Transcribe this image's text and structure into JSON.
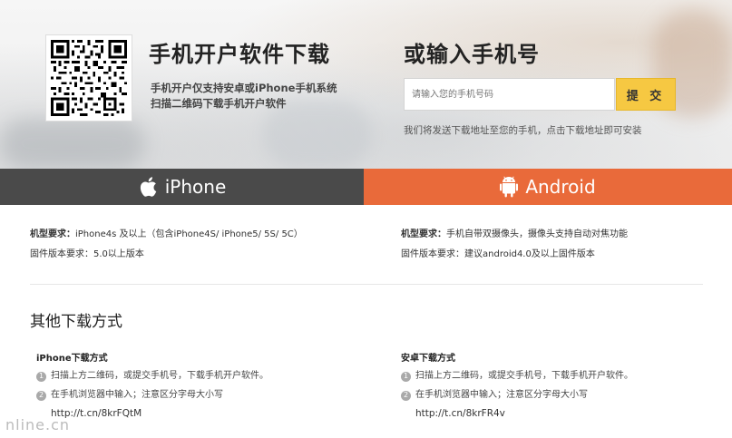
{
  "hero": {
    "download_title": "手机开户软件下载",
    "download_desc_1": "手机开户仅支持安卓或iPhone手机系统",
    "download_desc_2": "扫描二维码下载手机开户软件",
    "phone_title": "或输入手机号",
    "phone_placeholder": "请输入您的手机号码",
    "submit_label": "提 交",
    "phone_note": "我们将发送下载地址至您的手机，点击下载地址即可安装"
  },
  "tabs": {
    "iphone": "iPhone",
    "android": "Android",
    "iphone_color": "#4a4a4a",
    "android_color": "#e96a3a"
  },
  "requirements": {
    "iphone": {
      "model_label": "机型要求：",
      "model_value": "iPhone4s 及以上（包含iPhone4S/ iPhone5/ 5S/ 5C）",
      "firmware": "固件版本要求：5.0以上版本"
    },
    "android": {
      "model_label": "机型要求：",
      "model_value": "手机自带双摄像头，摄像头支持自动对焦功能",
      "firmware": "固件版本要求：建议android4.0及以上固件版本"
    }
  },
  "other": {
    "title": "其他下载方式",
    "iphone": {
      "heading": "iPhone下载方式",
      "step1": "扫描上方二维码，或提交手机号，下载手机开户软件。",
      "step2": "在手机浏览器中输入；注意区分字母大小写",
      "url": "http://t.cn/8krFQtM"
    },
    "android": {
      "heading": "安卓下载方式",
      "step1": "扫描上方二维码，或提交手机号，下载手机开户软件。",
      "step2": "在手机浏览器中输入；注意区分字母大小写",
      "url": "http://t.cn/8krFR4v"
    },
    "num1": "1",
    "num2": "2"
  },
  "watermark": "nline.cn"
}
